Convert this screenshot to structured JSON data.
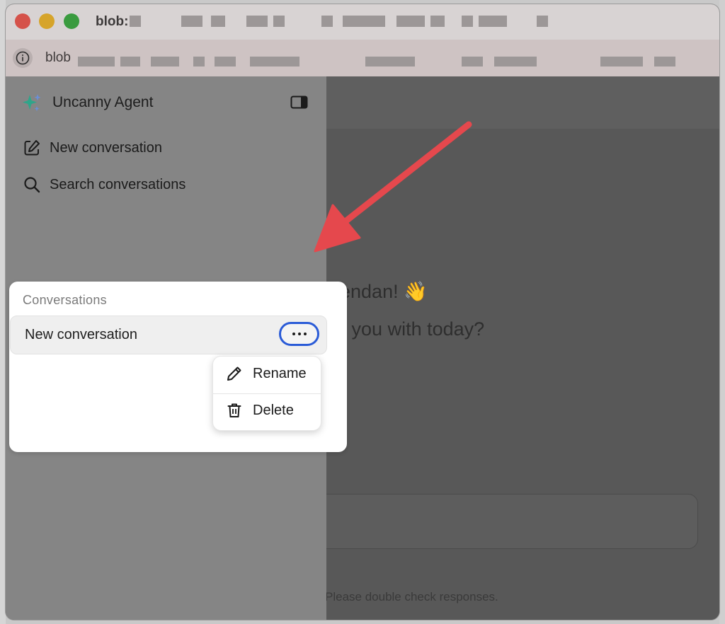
{
  "window": {
    "title": "blob:",
    "url": "blob"
  },
  "sidebar": {
    "brand": "Uncanny Agent",
    "nav": [
      {
        "label": "New conversation",
        "icon": "edit-icon"
      },
      {
        "label": "Search conversations",
        "icon": "search-icon"
      }
    ],
    "conversations": {
      "heading": "Conversations",
      "items": [
        {
          "label": "New conversation"
        }
      ]
    }
  },
  "context_menu": {
    "items": [
      {
        "label": "Rename",
        "icon": "pencil-icon"
      },
      {
        "label": "Delete",
        "icon": "trash-icon"
      }
    ]
  },
  "main": {
    "greeting_line1": "Brendan! 👋",
    "greeting_line2": "elp you with today?",
    "disclaimer": "Please double check responses."
  },
  "colors": {
    "annotation_arrow": "#e5484d",
    "focus_ring": "#2a5bd7"
  }
}
